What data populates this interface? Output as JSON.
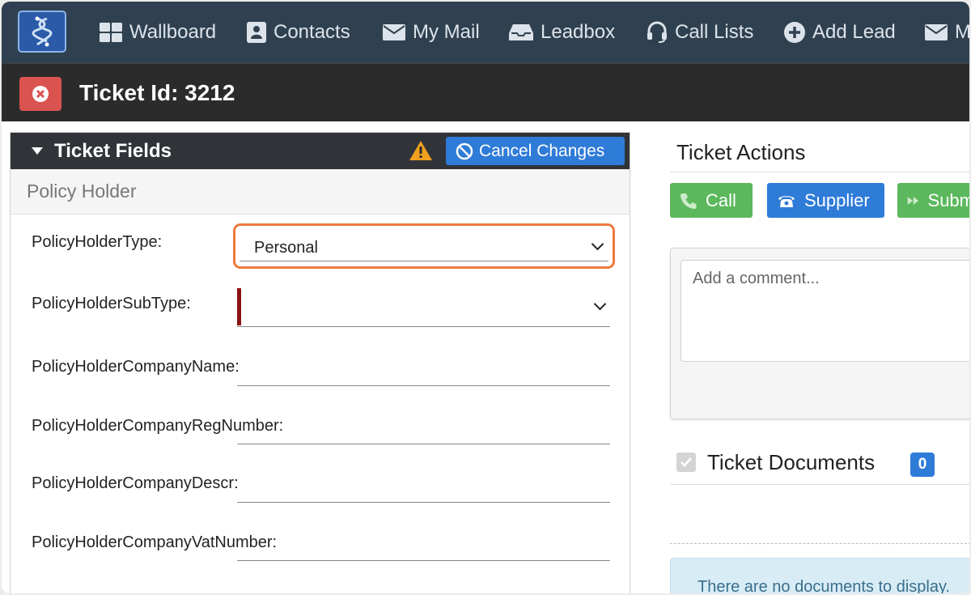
{
  "nav": {
    "items": [
      "Wallboard",
      "Contacts",
      "My Mail",
      "Leadbox",
      "Call Lists",
      "Add Lead",
      "M"
    ]
  },
  "ticket": {
    "title": "Ticket Id: 3212"
  },
  "ticket_fields": {
    "title": "Ticket Fields",
    "cancel_label": "Cancel Changes",
    "section_title": "Policy Holder",
    "fields": [
      {
        "label": "PolicyHolderType:",
        "value": "Personal"
      },
      {
        "label": "PolicyHolderSubType:",
        "value": ""
      },
      {
        "label": "PolicyHolderCompanyName:",
        "value": ""
      },
      {
        "label": "PolicyHolderCompanyRegNumber:",
        "value": ""
      },
      {
        "label": "PolicyHolderCompanyDescr:",
        "value": ""
      },
      {
        "label": "PolicyHolderCompanyVatNumber:",
        "value": ""
      }
    ]
  },
  "ticket_actions": {
    "title": "Ticket Actions",
    "buttons": [
      "Call",
      "Supplier",
      "Subm"
    ],
    "comment_placeholder": "Add a comment..."
  },
  "ticket_documents": {
    "title": "Ticket Documents",
    "count": "0",
    "empty_text": "There are no documents to display."
  },
  "colors": {
    "nav_bg": "#2f4150",
    "ticketbar_bg": "#2b2b2b",
    "close_red": "#d9534f",
    "primary_blue": "#2f7bd8",
    "call_green": "#5cb85c",
    "highlight_orange": "#ef7a3f"
  }
}
